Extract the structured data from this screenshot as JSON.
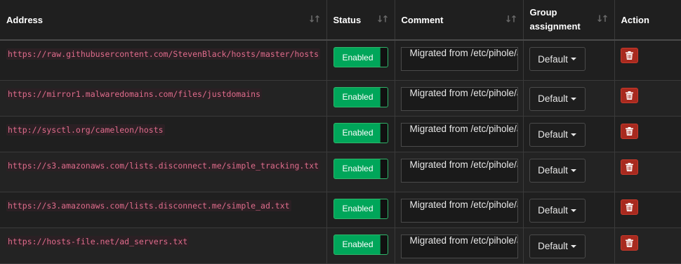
{
  "headers": {
    "address": "Address",
    "status": "Status",
    "comment": "Comment",
    "group_line1": "Group",
    "group_line2": "assignment",
    "action": "Action"
  },
  "sort_icon": "↓↑",
  "rows": [
    {
      "address": "https://raw.githubusercontent.com/StevenBlack/hosts/master/hosts",
      "status": "Enabled",
      "comment": "Migrated from /etc/pihole/adlists.list",
      "group": "Default"
    },
    {
      "address": "https://mirror1.malwaredomains.com/files/justdomains",
      "status": "Enabled",
      "comment": "Migrated from /etc/pihole/adlists.list",
      "group": "Default"
    },
    {
      "address": "http://sysctl.org/cameleon/hosts",
      "status": "Enabled",
      "comment": "Migrated from /etc/pihole/adlists.list",
      "group": "Default"
    },
    {
      "address": "https://s3.amazonaws.com/lists.disconnect.me/simple_tracking.txt",
      "status": "Enabled",
      "comment": "Migrated from /etc/pihole/adlists.list",
      "group": "Default"
    },
    {
      "address": "https://s3.amazonaws.com/lists.disconnect.me/simple_ad.txt",
      "status": "Enabled",
      "comment": "Migrated from /etc/pihole/adlists.list",
      "group": "Default"
    },
    {
      "address": "https://hosts-file.net/ad_servers.txt",
      "status": "Enabled",
      "comment": "Migrated from /etc/pihole/adlists.list",
      "group": "Default"
    }
  ],
  "colors": {
    "enabled_green": "#00a65a",
    "delete_red": "#a82a1f",
    "address_pink": "#e06c8c"
  },
  "icons": {
    "sort": "sort-icon",
    "delete": "trash-icon",
    "dropdown": "caret-down-icon"
  }
}
